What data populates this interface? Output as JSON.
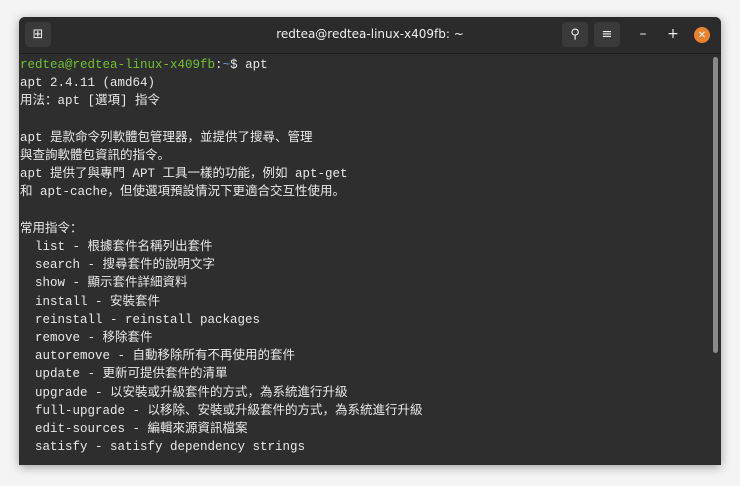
{
  "window": {
    "title": "redtea@redtea-linux-x409fb: ~"
  },
  "icons": {
    "new_tab": "new-tab-icon",
    "search": "search-icon",
    "menu": "hamburger-icon",
    "minimize": "minimize-icon",
    "maximize": "maximize-icon",
    "close": "close-icon"
  },
  "prompt": {
    "user_host": "redtea@redtea-linux-x409fb",
    "sep": ":",
    "path": "~",
    "symbol": "$ ",
    "command": "apt"
  },
  "output": [
    "apt 2.4.11 (amd64)",
    "用法：apt [選項] 指令",
    "",
    "apt 是款命令列軟體包管理器，並提供了搜尋、管理",
    "與查詢軟體包資訊的指令。",
    "apt 提供了與專門 APT 工具一樣的功能，例如 apt-get",
    "和 apt-cache，但使選項預設情況下更適合交互性使用。",
    "",
    "常用指令：",
    "  list - 根據套件名稱列出套件",
    "  search - 搜尋套件的說明文字",
    "  show - 顯示套件詳細資料",
    "  install - 安裝套件",
    "  reinstall - reinstall packages",
    "  remove - 移除套件",
    "  autoremove - 自動移除所有不再使用的套件",
    "  update - 更新可提供套件的清單",
    "  upgrade - 以安裝或升級套件的方式，為系統進行升級",
    "  full-upgrade - 以移除、安裝或升級套件的方式，為系統進行升級",
    "  edit-sources - 編輯來源資訊檔案",
    "  satisfy - satisfy dependency strings"
  ]
}
